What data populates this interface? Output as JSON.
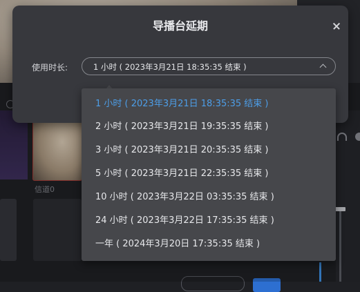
{
  "background": {
    "channel_label": "信道0"
  },
  "dialog": {
    "title": "导播台延期",
    "duration_label": "使用时长:",
    "selected_value": "1 小时 ( 2023年3月21日 18:35:35 结束 )",
    "options": [
      {
        "label": "1 小时 ( 2023年3月21日 18:35:35 结束 )",
        "selected": true
      },
      {
        "label": "2 小时 ( 2023年3月21日 19:35:35 结束 )",
        "selected": false
      },
      {
        "label": "3 小时 ( 2023年3月21日 20:35:35 结束 )",
        "selected": false
      },
      {
        "label": "5 小时 ( 2023年3月21日 22:35:35 结束 )",
        "selected": false
      },
      {
        "label": "10 小时 ( 2023年3月22日 03:35:35 结束 )",
        "selected": false
      },
      {
        "label": "24 小时 ( 2023年3月22日 17:35:35 结束 )",
        "selected": false
      },
      {
        "label": "一年 ( 2024年3月20日 17:35:35 结束 )",
        "selected": false
      }
    ]
  },
  "colors": {
    "selected_option": "#4d9ee8",
    "dialog_bg": "#37383d",
    "dropdown_bg": "#46474b"
  },
  "icons": {
    "close": "close-icon",
    "chevron": "chevron-up-icon"
  }
}
